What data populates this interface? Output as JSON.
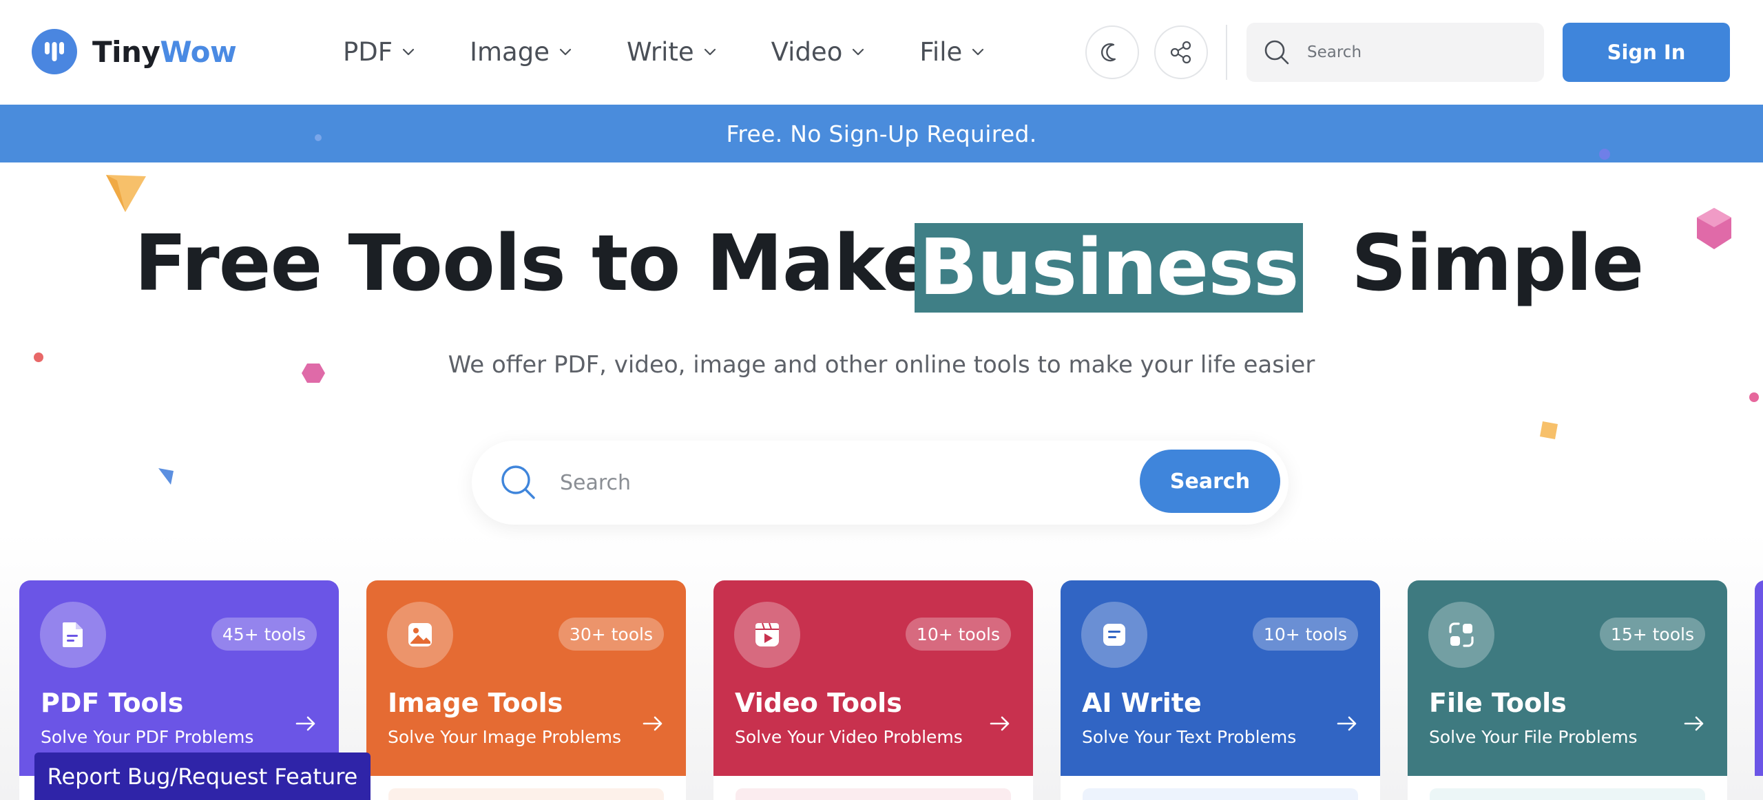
{
  "brand": {
    "name_part1": "Tiny",
    "name_part2": "Wow"
  },
  "nav": [
    {
      "label": "PDF"
    },
    {
      "label": "Image"
    },
    {
      "label": "Write"
    },
    {
      "label": "Video"
    },
    {
      "label": "File"
    }
  ],
  "header": {
    "search_placeholder": "Search",
    "sign_in_label": "Sign In"
  },
  "banner": {
    "text": "Free. No Sign-Up Required."
  },
  "hero": {
    "headline_start": "Free Tools to Make",
    "headline_highlight": "Business",
    "headline_end": "Simple",
    "subheading": "We offer PDF, video, image and other online tools to make your life easier",
    "search_placeholder": "Search",
    "search_button_label": "Search"
  },
  "cards": [
    {
      "title": "PDF Tools",
      "subtitle": "Solve Your PDF Problems",
      "badge": "45+ tools",
      "color": "#6b55e6",
      "icon": "pdf-document-icon"
    },
    {
      "title": "Image Tools",
      "subtitle": "Solve Your Image Problems",
      "badge": "30+ tools",
      "color": "#e56b33",
      "icon": "image-icon"
    },
    {
      "title": "Video Tools",
      "subtitle": "Solve Your Video Problems",
      "badge": "10+ tools",
      "color": "#c8314e",
      "icon": "video-play-icon"
    },
    {
      "title": "AI Write",
      "subtitle": "Solve Your Text Problems",
      "badge": "10+ tools",
      "color": "#3165c4",
      "icon": "text-document-icon"
    },
    {
      "title": "File Tools",
      "subtitle": "Solve Your File Problems",
      "badge": "15+ tools",
      "color": "#3e7a80",
      "icon": "file-convert-icon"
    }
  ],
  "report_button": {
    "label": "Report Bug/Request Feature"
  },
  "colors": {
    "primary": "#3f85db",
    "banner": "#4a8cdc",
    "highlight": "#3f7f86",
    "report": "#2f24a8"
  }
}
